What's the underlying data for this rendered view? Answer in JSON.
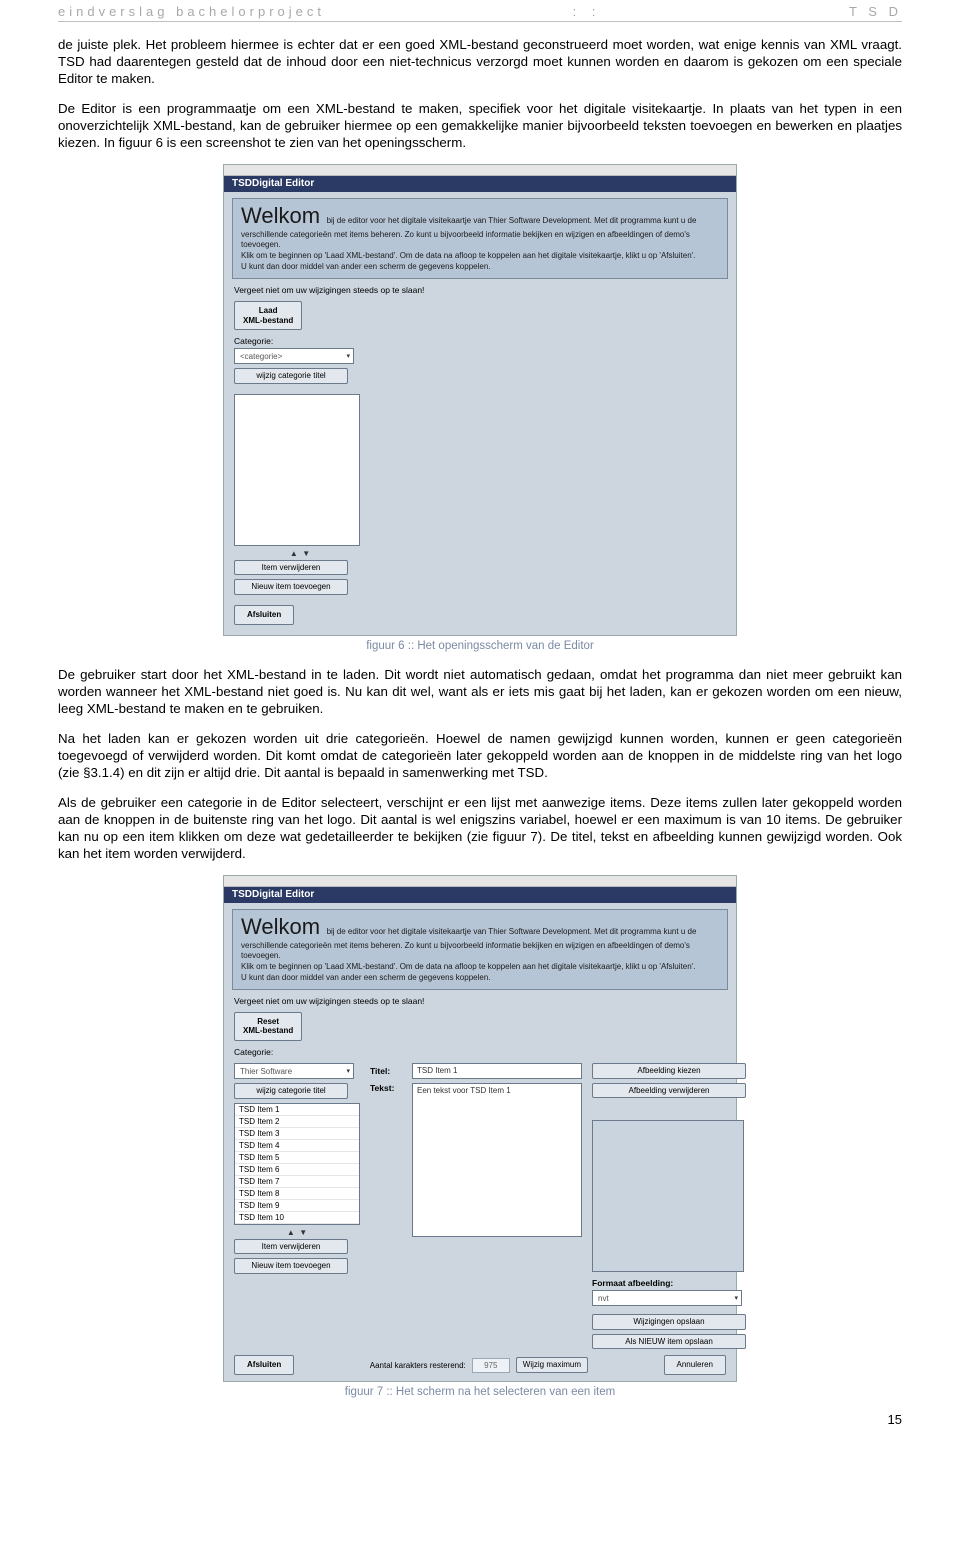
{
  "header": {
    "left": "eindverslag bachelorproject",
    "mid": ": :",
    "right": "T S D"
  },
  "paragraphs": {
    "p1": "de juiste plek. Het probleem hiermee is echter dat er een goed XML-bestand geconstrueerd moet worden, wat enige kennis van XML vraagt. TSD had daarentegen gesteld dat de inhoud door een niet-technicus verzorgd moet kunnen worden en daarom is gekozen om een speciale Editor te maken.",
    "p2": "De Editor is een programmaatje om een XML-bestand te maken, specifiek voor het digitale visitekaartje. In plaats van het typen in een onoverzichtelijk XML-bestand, kan de gebruiker hiermee op een gemakkelijke manier bijvoorbeeld teksten toevoegen en bewerken en plaatjes kiezen. In figuur 6 is een screenshot te zien van het openingsscherm.",
    "p3": "De gebruiker start door het XML-bestand in te laden. Dit wordt niet automatisch gedaan, omdat het programma dan niet meer gebruikt kan worden wanneer het XML-bestand niet goed is. Nu kan dit wel, want als er iets mis gaat bij het laden, kan er gekozen worden om een nieuw, leeg XML-bestand te maken en te gebruiken.",
    "p4": "Na het laden kan er gekozen worden uit drie categorieën. Hoewel de namen gewijzigd kunnen worden, kunnen er geen categorieën toegevoegd of verwijderd worden. Dit komt omdat de categorieën later gekoppeld worden aan de knoppen in de middelste ring van het logo (zie §3.1.4) en dit zijn er altijd drie. Dit aantal is bepaald in samenwerking met TSD.",
    "p5": "Als de gebruiker een categorie in de Editor selecteert, verschijnt er een lijst met aanwezige items. Deze items zullen later gekoppeld worden aan de knoppen in de buitenste ring van het logo. Dit aantal is wel enigszins variabel, hoewel er een maximum is van 10 items. De gebruiker kan nu op een item klikken om deze wat gedetailleerder te bekijken (zie figuur 7). De titel, tekst en afbeelding kunnen gewijzigd worden. Ook kan het item worden verwijderd."
  },
  "captions": {
    "c6": "figuur 6 :: Het openingsscherm van de Editor",
    "c7": "figuur 7 :: Het scherm na het selecteren van een item"
  },
  "pagenum": "15",
  "shot_common": {
    "app_title": "TSDDigital Editor",
    "welkom_head": "Welkom",
    "welkom_line1_tail": "bij de editor voor het digitale visitekaartje van Thier Software Development. Met dit programma kunt u de",
    "welkom_line2": "verschillende categorieën met items beheren. Zo kunt u bijvoorbeeld informatie bekijken en wijzigen en afbeeldingen of demo's toevoegen.",
    "welkom_line3": "Klik om te beginnen op 'Laad XML-bestand'. Om de data na afloop te koppelen aan het digitale visitekaartje, klikt u op 'Afsluiten'.",
    "welkom_line4": "U kunt dan door middel van ander een scherm de gegevens koppelen.",
    "tip": "Vergeet niet om uw wijzigingen steeds op te slaan!",
    "category_label": "Categorie:",
    "wijzig_cat": "wijzig categorie titel",
    "item_verwijderen": "Item verwijderen",
    "nieuw_item": "Nieuw item toevoegen",
    "afsluiten": "Afsluiten"
  },
  "shot1": {
    "laad_btn_line1": "Laad",
    "laad_btn_line2": "XML-bestand",
    "combo_placeholder": "<categorie>"
  },
  "shot2": {
    "reset_line1": "Reset",
    "reset_line2": "XML-bestand",
    "combo_value": "Thier Software",
    "items": [
      "TSD Item 1",
      "TSD Item 2",
      "TSD Item 3",
      "TSD Item 4",
      "TSD Item 5",
      "TSD Item 6",
      "TSD Item 7",
      "TSD Item 8",
      "TSD Item 9",
      "TSD Item 10"
    ],
    "titel_label": "Titel:",
    "titel_value": "TSD Item 1",
    "tekst_label": "Tekst:",
    "tekst_value": "Een tekst voor TSD Item 1",
    "afb_kiezen": "Afbeelding kiezen",
    "afb_verwijderen": "Afbeelding verwijderen",
    "formaat_label": "Formaat afbeelding:",
    "formaat_value": "nvt",
    "wijz_opslaan": "Wijzigingen opslaan",
    "als_nieuw": "Als NIEUW item opslaan",
    "kars_label": "Aantal karakters resterend:",
    "kars_value": "975",
    "wijzig_max": "Wijzig maximum",
    "annuleren": "Annuleren"
  }
}
